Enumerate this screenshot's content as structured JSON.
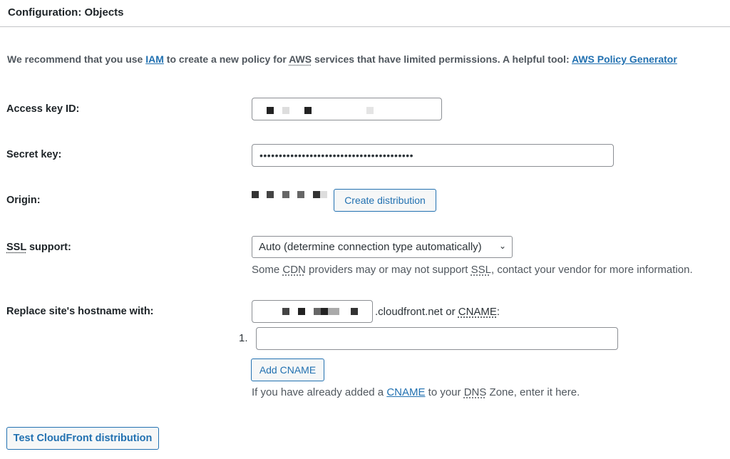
{
  "header": {
    "title": "Configuration: Objects"
  },
  "intro": {
    "part1": "We recommend that you use ",
    "iam_link": "IAM",
    "part2": " to create a new policy for ",
    "aws_abbr": "AWS",
    "part3": " services that have limited permissions. A helpful tool: ",
    "policy_link": "AWS Policy Generator"
  },
  "fields": {
    "access_key": {
      "label": "Access key ID:",
      "value": "[redacted]"
    },
    "secret_key": {
      "label": "Secret key:",
      "value": "••••••••••••••••••••••••••••••••••••••••"
    },
    "origin": {
      "label": "Origin:",
      "value": "[redacted]",
      "button": "Create distribution"
    },
    "ssl": {
      "label_abbr": "SSL",
      "label_rest": " support:",
      "selected": "Auto (determine connection type automatically)",
      "desc_part1": "Some ",
      "desc_cdn": "CDN",
      "desc_part2": " providers may or may not support ",
      "desc_ssl": "SSL",
      "desc_part3": ", contact your vendor for more information."
    },
    "hostname": {
      "label": "Replace site's hostname with:",
      "value": "[redacted]",
      "suffix_part1": ".cloudfront.net or ",
      "suffix_cname": "CNAME",
      "suffix_part2": ":",
      "cname_index": "1.",
      "cname_value": "",
      "add_button": "Add CNAME",
      "help_part1": "If you have already added a ",
      "help_cname": "CNAME",
      "help_part2": " to your ",
      "help_dns": "DNS",
      "help_part3": " Zone, enter it here."
    }
  },
  "test_button": "Test CloudFront distribution"
}
